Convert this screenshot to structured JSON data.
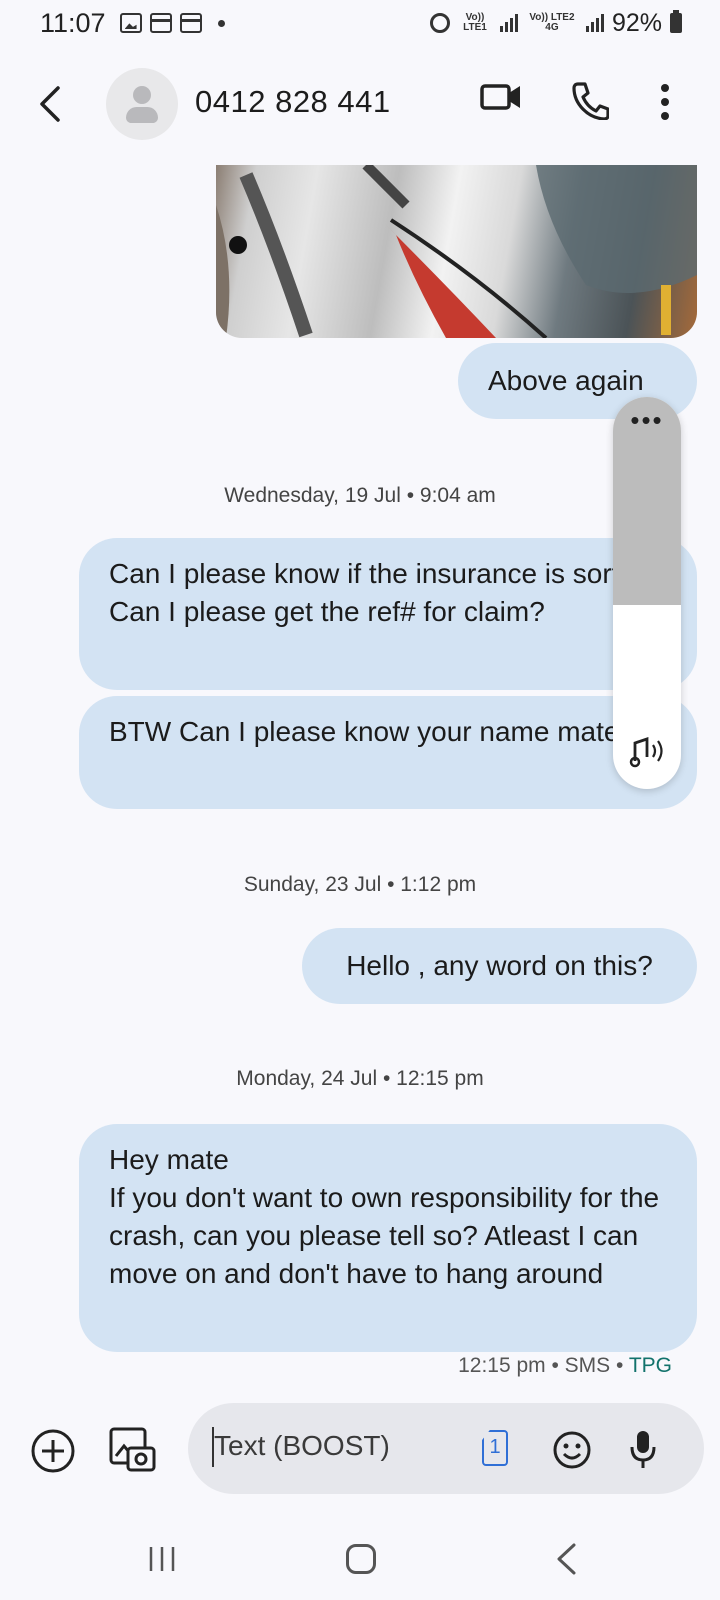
{
  "status_bar": {
    "time": "11:07",
    "sim1_label": "Vo)) LTE1",
    "sim2_label": "Vo)) LTE2 4G",
    "battery": "92%"
  },
  "header": {
    "contact": "0412 828 441"
  },
  "messages": {
    "above_again": "Above again",
    "date1": "Wednesday, 19 Jul • 9:04 am",
    "insurance": "Can I please know if the insurance is sorted? Can I please get the ref# for claim?",
    "btw": "BTW Can I please know your name mate?",
    "date2": "Sunday, 23 Jul • 1:12 pm",
    "hello": "Hello , any word on this?",
    "date3": "Monday, 24 Jul • 12:15 pm",
    "hey": "Hey mate\nIf you don't want to own responsibility for the crash,  can you please tell so? Atleast I can move on and don't have to hang around",
    "meta_time": "12:15 pm • SMS • ",
    "meta_carrier": "TPG"
  },
  "scroll_popup": {
    "dots": "•••"
  },
  "composer": {
    "placeholder": "Text (BOOST)",
    "sim_number": "1"
  },
  "icons": {
    "back": "chevron-left-icon",
    "video": "video-call-icon",
    "phone": "phone-icon",
    "more": "more-vert-icon",
    "add": "add-circle-icon",
    "gallery": "gallery-camera-icon",
    "emoji": "emoji-icon",
    "mic": "mic-icon"
  }
}
